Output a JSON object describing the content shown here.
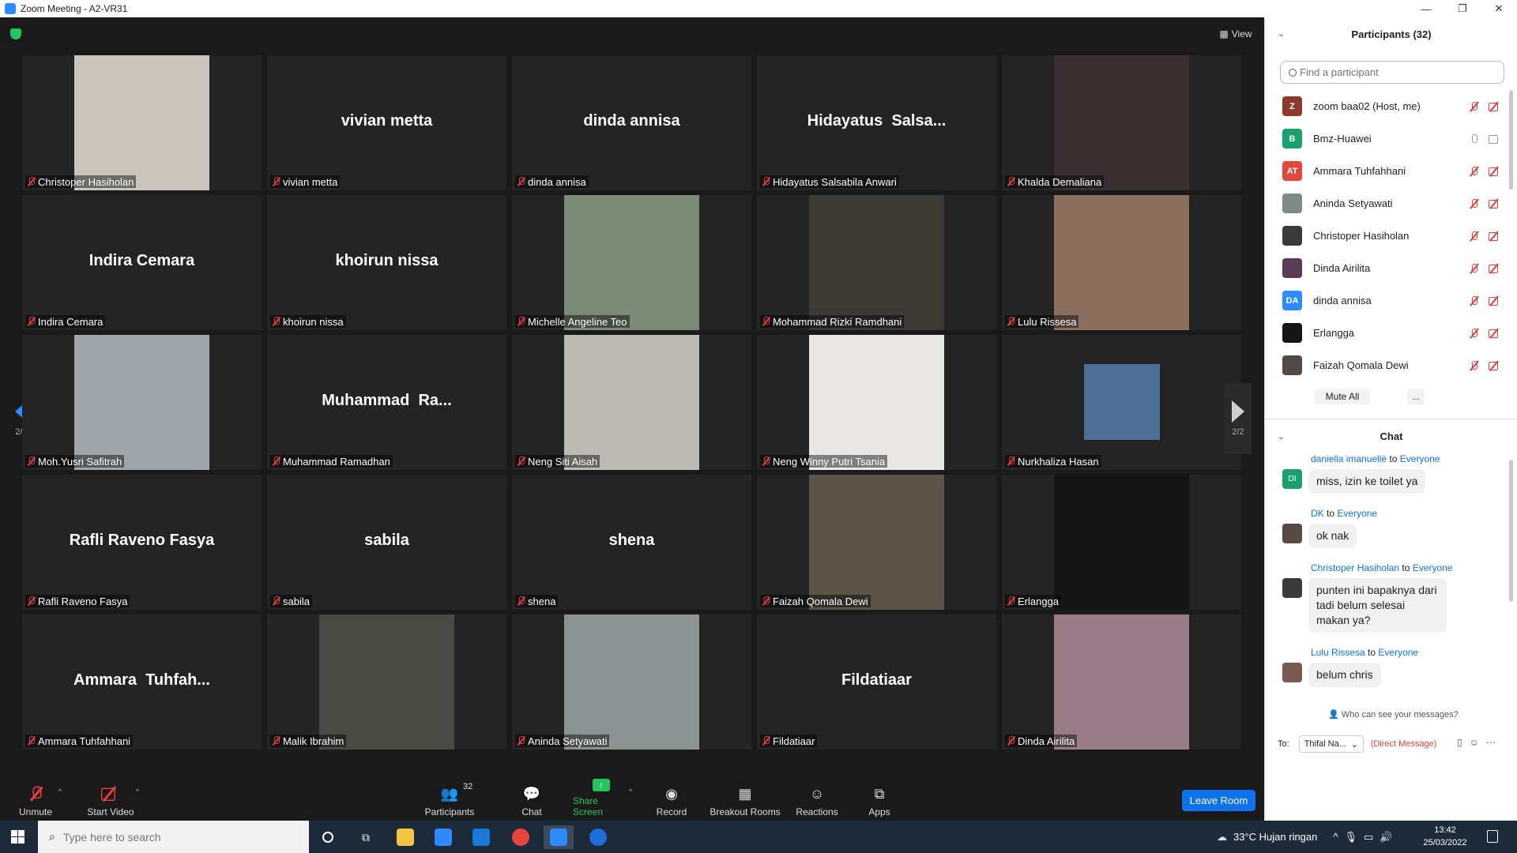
{
  "window": {
    "title": "Zoom Meeting - A2-VR31",
    "min": "—",
    "restore": "❐",
    "close": "✕"
  },
  "view_label": "View",
  "pager": {
    "page": "2/2"
  },
  "tiles": [
    {
      "label": "Christoper Hasiholan",
      "big": "",
      "photo": "#c9c5bd"
    },
    {
      "label": "vivian metta",
      "big": "vivian metta",
      "photo": ""
    },
    {
      "label": "dinda annisa",
      "big": "dinda annisa",
      "photo": ""
    },
    {
      "label": "Hidayatus Salsabila Anwari",
      "big": "Hidayatus  Salsa...",
      "photo": ""
    },
    {
      "label": "Khalda Demaliana",
      "big": "",
      "photo": "#3a3032"
    },
    {
      "label": "Indira Cemara",
      "big": "Indira Cemara",
      "photo": ""
    },
    {
      "label": "khoirun nissa",
      "big": "khoirun nissa",
      "photo": ""
    },
    {
      "label": "Michelle Angeline Teo",
      "big": "",
      "photo": "#7c8a78"
    },
    {
      "label": "Mohammad Rizki Ramdhani",
      "big": "",
      "photo": "#3d3a36"
    },
    {
      "label": "Lulu Rissesa",
      "big": "",
      "photo": "#8a6e5e"
    },
    {
      "label": "Moh.Yusri Safitrah",
      "big": "",
      "photo": "#9fa6ab"
    },
    {
      "label": "Muhammad Ramadhan",
      "big": "Muhammad  Ra...",
      "photo": ""
    },
    {
      "label": "Neng Siti Aisah",
      "big": "",
      "photo": "#bdbab5"
    },
    {
      "label": "Neng Winny Putri Tsania",
      "big": "",
      "photo": "#e9e7e4"
    },
    {
      "label": "Nurkhaliza Hasan",
      "big": "",
      "photo": "#4d6f95",
      "small": true
    },
    {
      "label": "Rafli Raveno Fasya",
      "big": "Rafli Raveno Fasya",
      "photo": ""
    },
    {
      "label": "sabila",
      "big": "sabila",
      "photo": ""
    },
    {
      "label": "shena",
      "big": "shena",
      "photo": ""
    },
    {
      "label": "Faizah Qomala Dewi",
      "big": "",
      "photo": "#5c5349"
    },
    {
      "label": "Erlangga",
      "big": "",
      "photo": "#151515"
    },
    {
      "label": "Ammara Tuhfahhani",
      "big": "Ammara  Tuhfah...",
      "photo": ""
    },
    {
      "label": "Malik Ibrahim",
      "big": "",
      "photo": "#4a4a44"
    },
    {
      "label": "Aninda Setyawati",
      "big": "",
      "photo": "#8d9293"
    },
    {
      "label": "Fildatiaar",
      "big": "Fildatiaar",
      "photo": ""
    },
    {
      "label": "Dinda Airilita",
      "big": "",
      "photo": "#9a7b88"
    }
  ],
  "toolbar": {
    "unmute": "Unmute",
    "start_video": "Start Video",
    "participants": "Participants",
    "participants_count": "32",
    "chat": "Chat",
    "share_screen": "Share Screen",
    "record": "Record",
    "breakout_rooms": "Breakout Rooms",
    "reactions": "Reactions",
    "apps": "Apps",
    "leave": "Leave Room"
  },
  "participants_panel": {
    "title": "Participants (32)",
    "search_placeholder": "Find a participant",
    "items": [
      {
        "initials": "Z",
        "color": "#8b3a2b",
        "name": "zoom baa02 (Host, me)",
        "mic": "off",
        "cam": "off"
      },
      {
        "initials": "B",
        "color": "#1aa06d",
        "name": "Bmz-Huawei",
        "mic": "on",
        "cam": "on"
      },
      {
        "initials": "AT",
        "color": "#e0483b",
        "name": "Ammara Tuhfahhani",
        "mic": "off",
        "cam": "off"
      },
      {
        "initials": "",
        "color": "#7d8a88",
        "name": "Aninda Setyawati",
        "mic": "off",
        "cam": "off"
      },
      {
        "initials": "",
        "color": "#3a3a3a",
        "name": "Christoper Hasiholan",
        "mic": "off",
        "cam": "off"
      },
      {
        "initials": "",
        "color": "#5a3a55",
        "name": "Dinda Airilita",
        "mic": "off",
        "cam": "off"
      },
      {
        "initials": "DA",
        "color": "#2d8cff",
        "name": "dinda annisa",
        "mic": "off",
        "cam": "off"
      },
      {
        "initials": "",
        "color": "#151515",
        "name": "Erlangga",
        "mic": "off",
        "cam": "off"
      },
      {
        "initials": "",
        "color": "#4f4a45",
        "name": "Faizah Qomala Dewi",
        "mic": "off",
        "cam": "off"
      }
    ],
    "mute_all": "Mute All",
    "more": "..."
  },
  "chat_panel": {
    "title": "Chat",
    "to_word": "to",
    "messages": [
      {
        "from": "daniella imanuellè",
        "to": "Everyone",
        "text": "miss, izin ke toilet ya",
        "initials": "DI",
        "color": "#1aa06d"
      },
      {
        "from": "DK",
        "to": "Everyone",
        "text": "ok nak",
        "initials": "",
        "color": "#5a4a45"
      },
      {
        "from": "Christoper Hasiholan",
        "to": "Everyone",
        "text": "punten ini bapaknya dari tadi belum selesai makan ya?",
        "initials": "",
        "color": "#3a3a3a"
      },
      {
        "from": "Lulu Rissesa",
        "to": "Everyone",
        "text": "belum chris",
        "initials": "",
        "color": "#7a5a50"
      }
    ],
    "who_can_see": "Who can see your messages?",
    "to_label": "To:",
    "recipient": "Thifal Na...",
    "direct": "(Direct Message)"
  },
  "taskbar": {
    "search_placeholder": "Type here to search",
    "weather": "33°C  Hujan ringan",
    "time": "13:42",
    "date": "25/03/2022"
  }
}
